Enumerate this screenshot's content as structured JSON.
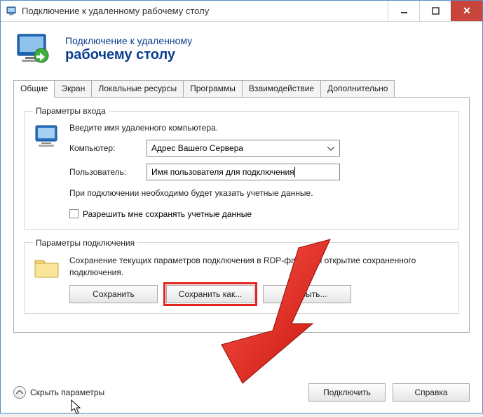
{
  "titlebar": {
    "title": "Подключение к удаленному рабочему столу"
  },
  "header": {
    "line1": "Подключение к удаленному",
    "line2": "рабочему столу"
  },
  "tabs": [
    {
      "label": "Общие"
    },
    {
      "label": "Экран"
    },
    {
      "label": "Локальные ресурсы"
    },
    {
      "label": "Программы"
    },
    {
      "label": "Взаимодействие"
    },
    {
      "label": "Дополнительно"
    }
  ],
  "login": {
    "legend": "Параметры входа",
    "instruction": "Введите имя удаленного компьютера.",
    "computer_label": "Компьютер:",
    "computer_value": "Адрес Вашего Сервера",
    "user_label": "Пользователь:",
    "user_value": "Имя пользователя для подключения",
    "note": "При подключении необходимо будет указать учетные данные.",
    "checkbox_label": "Разрешить мне сохранять учетные данные"
  },
  "connection": {
    "legend": "Параметры подключения",
    "desc": "Сохранение текущих параметров подключения в RDP-файл или открытие сохраненного подключения.",
    "save_label": "Сохранить",
    "saveas_label": "Сохранить как...",
    "open_label": "Открыть..."
  },
  "footer": {
    "toggle_label": "Скрыть параметры",
    "connect_label": "Подключить",
    "help_label": "Справка"
  }
}
